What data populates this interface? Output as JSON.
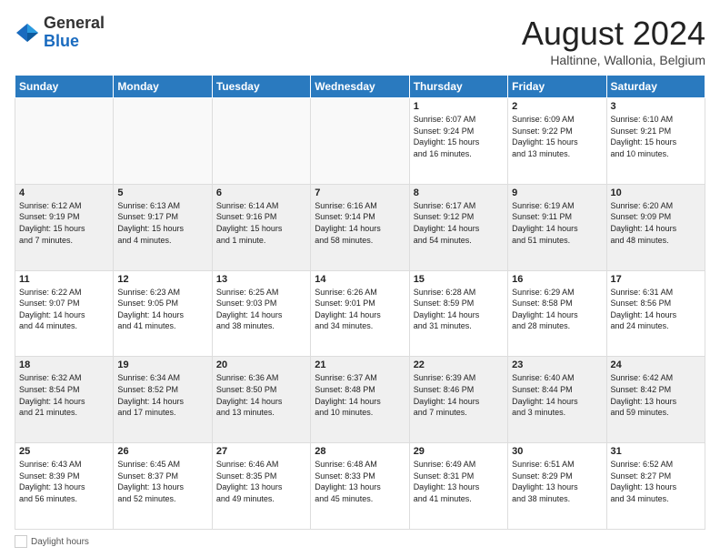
{
  "logo": {
    "general": "General",
    "blue": "Blue"
  },
  "header": {
    "month_title": "August 2024",
    "subtitle": "Haltinne, Wallonia, Belgium"
  },
  "weekdays": [
    "Sunday",
    "Monday",
    "Tuesday",
    "Wednesday",
    "Thursday",
    "Friday",
    "Saturday"
  ],
  "weeks": [
    [
      {
        "day": "",
        "info": ""
      },
      {
        "day": "",
        "info": ""
      },
      {
        "day": "",
        "info": ""
      },
      {
        "day": "",
        "info": ""
      },
      {
        "day": "1",
        "info": "Sunrise: 6:07 AM\nSunset: 9:24 PM\nDaylight: 15 hours\nand 16 minutes."
      },
      {
        "day": "2",
        "info": "Sunrise: 6:09 AM\nSunset: 9:22 PM\nDaylight: 15 hours\nand 13 minutes."
      },
      {
        "day": "3",
        "info": "Sunrise: 6:10 AM\nSunset: 9:21 PM\nDaylight: 15 hours\nand 10 minutes."
      }
    ],
    [
      {
        "day": "4",
        "info": "Sunrise: 6:12 AM\nSunset: 9:19 PM\nDaylight: 15 hours\nand 7 minutes."
      },
      {
        "day": "5",
        "info": "Sunrise: 6:13 AM\nSunset: 9:17 PM\nDaylight: 15 hours\nand 4 minutes."
      },
      {
        "day": "6",
        "info": "Sunrise: 6:14 AM\nSunset: 9:16 PM\nDaylight: 15 hours\nand 1 minute."
      },
      {
        "day": "7",
        "info": "Sunrise: 6:16 AM\nSunset: 9:14 PM\nDaylight: 14 hours\nand 58 minutes."
      },
      {
        "day": "8",
        "info": "Sunrise: 6:17 AM\nSunset: 9:12 PM\nDaylight: 14 hours\nand 54 minutes."
      },
      {
        "day": "9",
        "info": "Sunrise: 6:19 AM\nSunset: 9:11 PM\nDaylight: 14 hours\nand 51 minutes."
      },
      {
        "day": "10",
        "info": "Sunrise: 6:20 AM\nSunset: 9:09 PM\nDaylight: 14 hours\nand 48 minutes."
      }
    ],
    [
      {
        "day": "11",
        "info": "Sunrise: 6:22 AM\nSunset: 9:07 PM\nDaylight: 14 hours\nand 44 minutes."
      },
      {
        "day": "12",
        "info": "Sunrise: 6:23 AM\nSunset: 9:05 PM\nDaylight: 14 hours\nand 41 minutes."
      },
      {
        "day": "13",
        "info": "Sunrise: 6:25 AM\nSunset: 9:03 PM\nDaylight: 14 hours\nand 38 minutes."
      },
      {
        "day": "14",
        "info": "Sunrise: 6:26 AM\nSunset: 9:01 PM\nDaylight: 14 hours\nand 34 minutes."
      },
      {
        "day": "15",
        "info": "Sunrise: 6:28 AM\nSunset: 8:59 PM\nDaylight: 14 hours\nand 31 minutes."
      },
      {
        "day": "16",
        "info": "Sunrise: 6:29 AM\nSunset: 8:58 PM\nDaylight: 14 hours\nand 28 minutes."
      },
      {
        "day": "17",
        "info": "Sunrise: 6:31 AM\nSunset: 8:56 PM\nDaylight: 14 hours\nand 24 minutes."
      }
    ],
    [
      {
        "day": "18",
        "info": "Sunrise: 6:32 AM\nSunset: 8:54 PM\nDaylight: 14 hours\nand 21 minutes."
      },
      {
        "day": "19",
        "info": "Sunrise: 6:34 AM\nSunset: 8:52 PM\nDaylight: 14 hours\nand 17 minutes."
      },
      {
        "day": "20",
        "info": "Sunrise: 6:36 AM\nSunset: 8:50 PM\nDaylight: 14 hours\nand 13 minutes."
      },
      {
        "day": "21",
        "info": "Sunrise: 6:37 AM\nSunset: 8:48 PM\nDaylight: 14 hours\nand 10 minutes."
      },
      {
        "day": "22",
        "info": "Sunrise: 6:39 AM\nSunset: 8:46 PM\nDaylight: 14 hours\nand 7 minutes."
      },
      {
        "day": "23",
        "info": "Sunrise: 6:40 AM\nSunset: 8:44 PM\nDaylight: 14 hours\nand 3 minutes."
      },
      {
        "day": "24",
        "info": "Sunrise: 6:42 AM\nSunset: 8:42 PM\nDaylight: 13 hours\nand 59 minutes."
      }
    ],
    [
      {
        "day": "25",
        "info": "Sunrise: 6:43 AM\nSunset: 8:39 PM\nDaylight: 13 hours\nand 56 minutes."
      },
      {
        "day": "26",
        "info": "Sunrise: 6:45 AM\nSunset: 8:37 PM\nDaylight: 13 hours\nand 52 minutes."
      },
      {
        "day": "27",
        "info": "Sunrise: 6:46 AM\nSunset: 8:35 PM\nDaylight: 13 hours\nand 49 minutes."
      },
      {
        "day": "28",
        "info": "Sunrise: 6:48 AM\nSunset: 8:33 PM\nDaylight: 13 hours\nand 45 minutes."
      },
      {
        "day": "29",
        "info": "Sunrise: 6:49 AM\nSunset: 8:31 PM\nDaylight: 13 hours\nand 41 minutes."
      },
      {
        "day": "30",
        "info": "Sunrise: 6:51 AM\nSunset: 8:29 PM\nDaylight: 13 hours\nand 38 minutes."
      },
      {
        "day": "31",
        "info": "Sunrise: 6:52 AM\nSunset: 8:27 PM\nDaylight: 13 hours\nand 34 minutes."
      }
    ]
  ],
  "legend": {
    "daylight_label": "Daylight hours"
  }
}
